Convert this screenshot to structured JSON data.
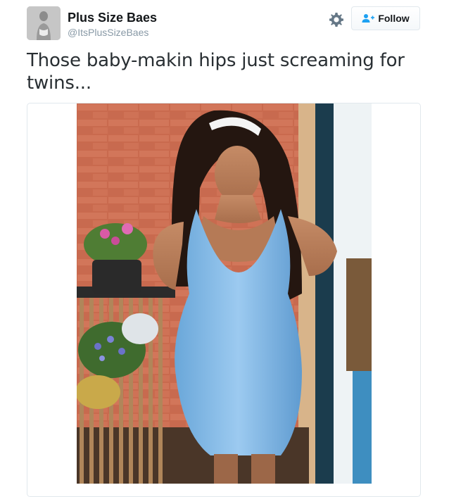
{
  "tweet": {
    "author": {
      "display_name": "Plus Size Baes",
      "handle": "@ItsPlusSizeBaes",
      "avatar_icon": "avatar-photo"
    },
    "actions": {
      "settings_icon": "gear-icon",
      "follow_label": "Follow",
      "follow_icon": "add-user-icon"
    },
    "text": "Those baby-makin hips just screaming for twins...",
    "media": {
      "type": "photo"
    }
  },
  "colors": {
    "name": "#14171a",
    "handle": "#8899a6",
    "accent": "#1da1f2",
    "border": "#e1e8ed"
  }
}
